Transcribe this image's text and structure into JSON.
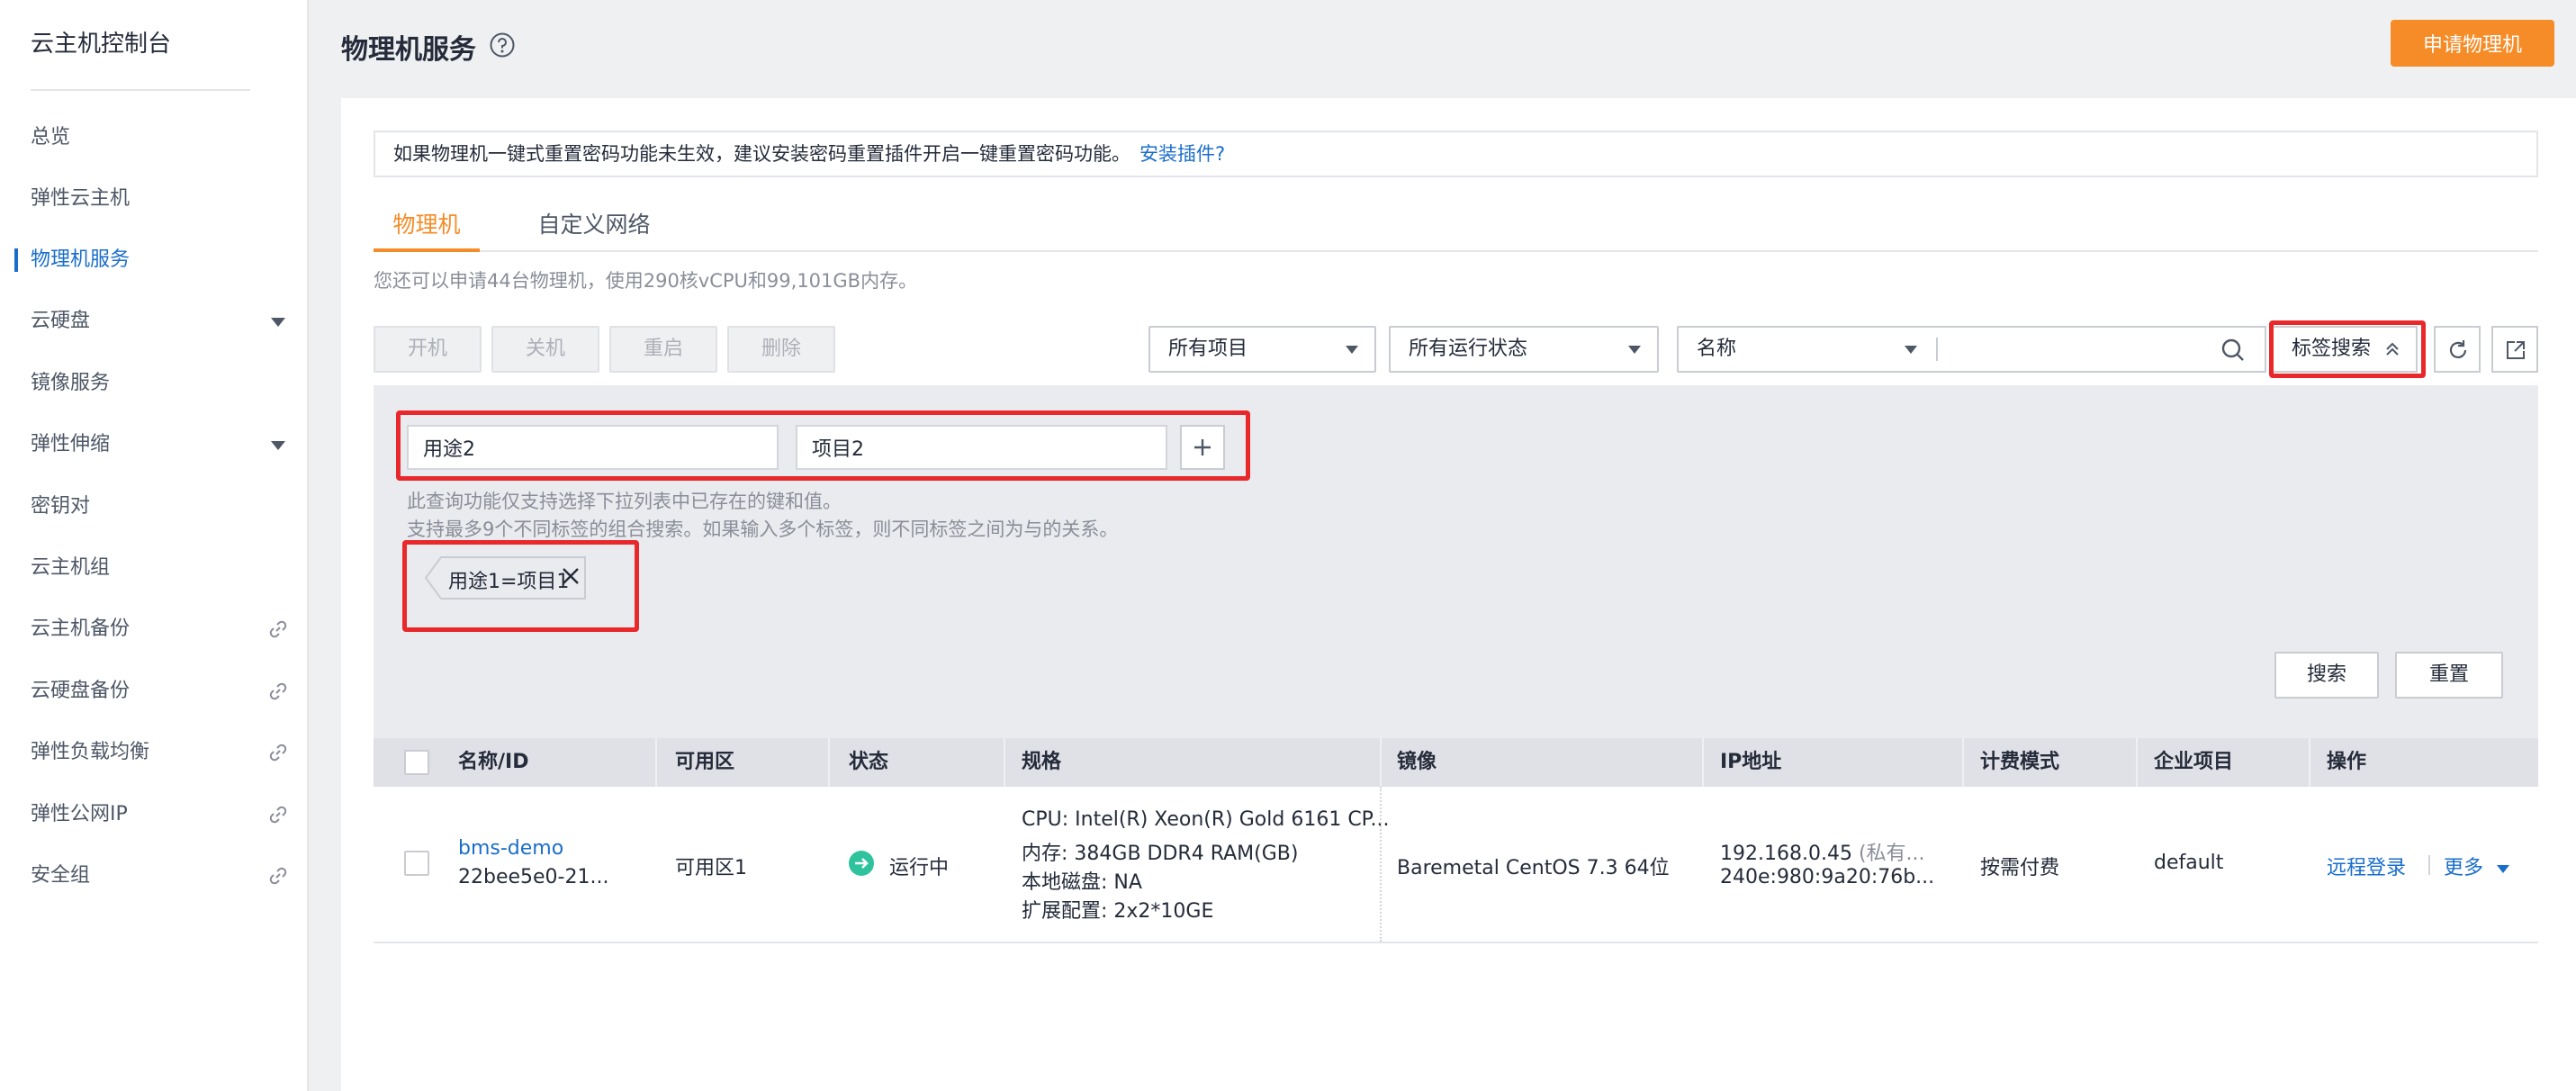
{
  "sidebar": {
    "title": "云主机控制台",
    "items": [
      {
        "label": "总览"
      },
      {
        "label": "弹性云主机"
      },
      {
        "label": "物理机服务"
      },
      {
        "label": "云硬盘"
      },
      {
        "label": "镜像服务"
      },
      {
        "label": "弹性伸缩"
      },
      {
        "label": "密钥对"
      },
      {
        "label": "云主机组"
      },
      {
        "label": "云主机备份"
      },
      {
        "label": "云硬盘备份"
      },
      {
        "label": "弹性负载均衡"
      },
      {
        "label": "弹性公网IP"
      },
      {
        "label": "安全组"
      }
    ]
  },
  "header": {
    "title": "物理机服务",
    "apply_label": "申请物理机"
  },
  "notice": {
    "text": "如果物理机一键式重置密码功能未生效，建议安装密码重置插件开启一键重置密码功能。",
    "link": "安装插件?"
  },
  "tabs": [
    "物理机",
    "自定义网络"
  ],
  "quota_text": "您还可以申请44台物理机，使用290核vCPU和99,101GB内存。",
  "toolbar": {
    "start": "开机",
    "stop": "关机",
    "restart": "重启",
    "delete": "删除",
    "project_filter": "所有项目",
    "status_filter": "所有运行状态",
    "search_field": "名称",
    "search_value": "",
    "tag_search": "标签搜索"
  },
  "tag_search": {
    "key_value": "用途2",
    "value_value": "项目2",
    "hint_1": "此查询功能仅支持选择下拉列表中已存在的键和值。",
    "hint_2": "支持最多9个不同标签的组合搜索。如果输入多个标签，则不同标签之间为与的关系。",
    "chip": "用途1=项目1",
    "search_button": "搜索",
    "reset_button": "重置"
  },
  "table": {
    "columns": [
      "名称/ID",
      "可用区",
      "状态",
      "规格",
      "镜像",
      "IP地址",
      "计费模式",
      "企业项目",
      "操作"
    ],
    "rows": [
      {
        "name": "bms-demo",
        "id": "22bee5e0-21...",
        "zone": "可用区1",
        "status": "运行中",
        "spec": [
          "CPU: Intel(R) Xeon(R) Gold 6161 CP...",
          "内存: 384GB DDR4 RAM(GB)",
          "本地磁盘: NA",
          "扩展配置: 2x2*10GE"
        ],
        "image": "Baremetal CentOS 7.3 64位",
        "ip_1": "192.168.0.45",
        "ip_1_note": "(私有...",
        "ip_2": "240e:980:9a20:76b...",
        "billing": "按需付费",
        "enterprise_project": "default",
        "action_remote": "远程登录",
        "action_more": "更多"
      }
    ]
  },
  "colors": {
    "accent_orange": "#f68c27",
    "link_blue": "#1a6ecb",
    "highlight_red": "#e8282a",
    "status_green": "#2ec29d"
  }
}
